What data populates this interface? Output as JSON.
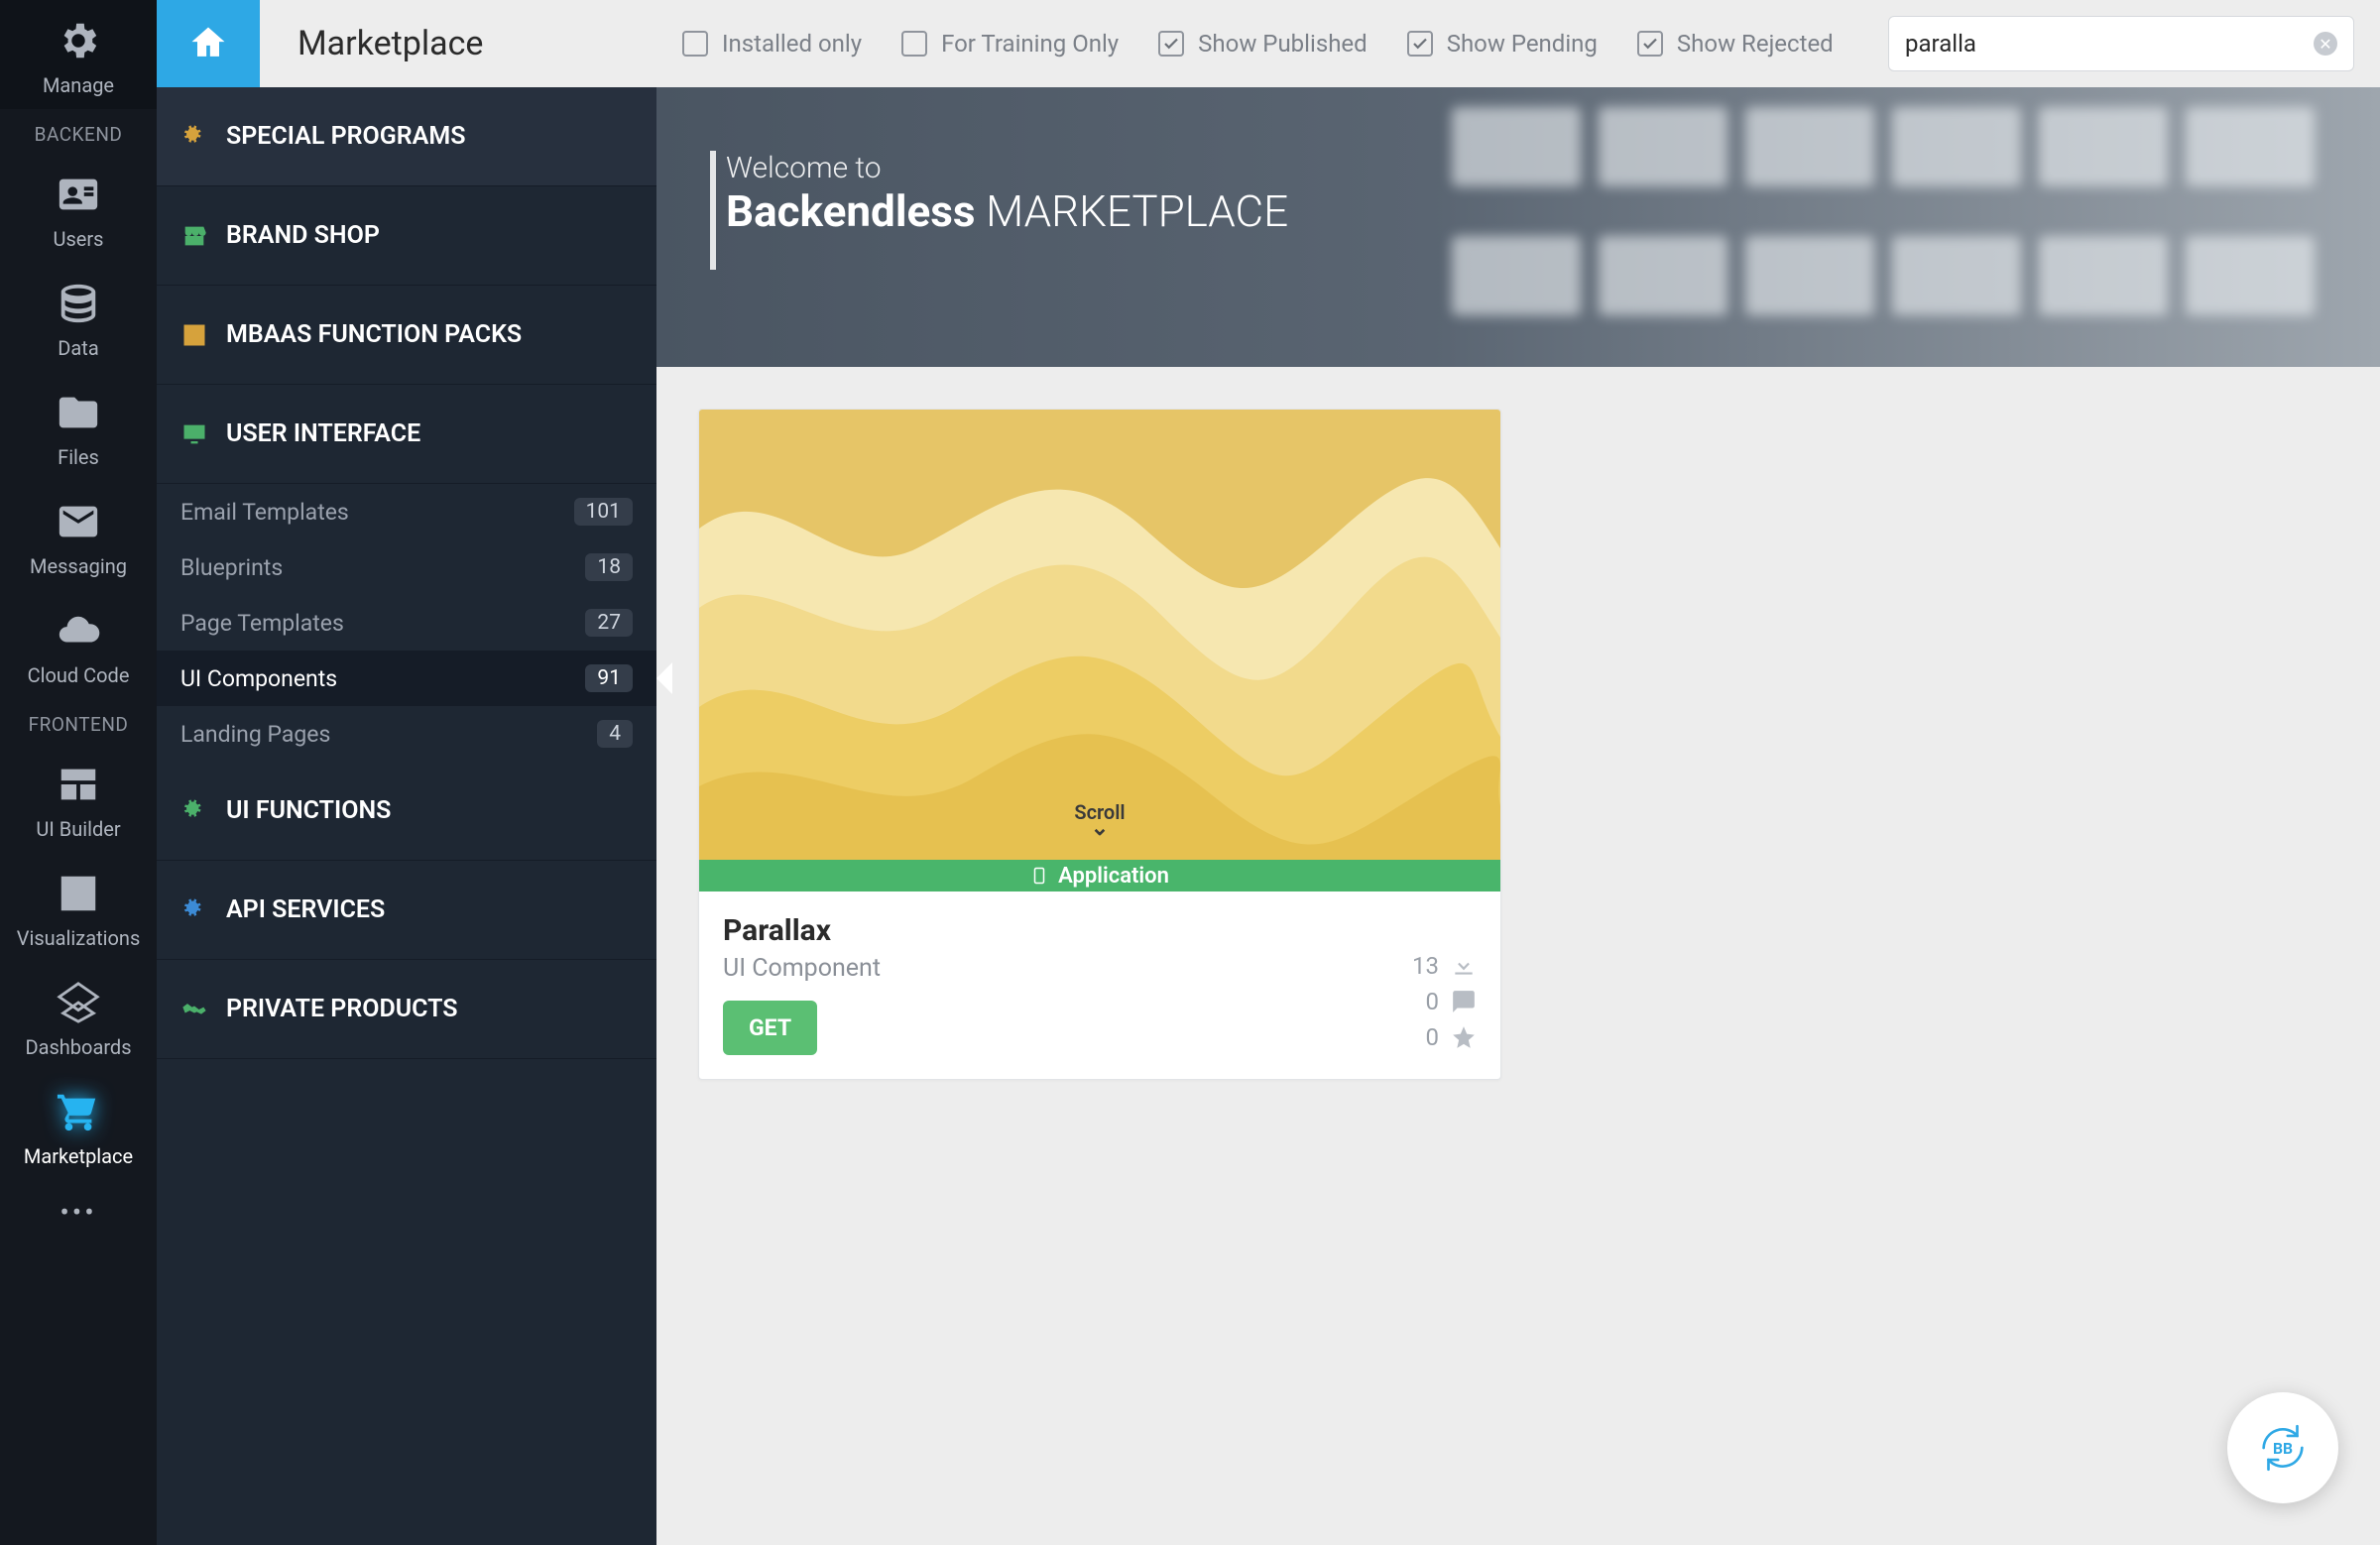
{
  "header": {
    "title": "Marketplace"
  },
  "rail": {
    "manage": "Manage",
    "section_backend": "BACKEND",
    "users": "Users",
    "data": "Data",
    "files": "Files",
    "messaging": "Messaging",
    "cloudcode": "Cloud Code",
    "section_frontend": "FRONTEND",
    "uibuilder": "UI Builder",
    "visualizations": "Visualizations",
    "dashboards": "Dashboards",
    "marketplace": "Marketplace"
  },
  "categories": {
    "special": "SPECIAL PROGRAMS",
    "brand": "BRAND SHOP",
    "mbaas": "MBAAS FUNCTION PACKS",
    "ui": "USER INTERFACE",
    "ui_items": [
      {
        "label": "Email Templates",
        "count": "101"
      },
      {
        "label": "Blueprints",
        "count": "18"
      },
      {
        "label": "Page Templates",
        "count": "27"
      },
      {
        "label": "UI Components",
        "count": "91"
      },
      {
        "label": "Landing Pages",
        "count": "4"
      }
    ],
    "uifunc": "UI FUNCTIONS",
    "api": "API SERVICES",
    "private": "PRIVATE PRODUCTS"
  },
  "filters": {
    "installed": "Installed only",
    "training": "For Training Only",
    "published": "Show Published",
    "pending": "Show Pending",
    "rejected": "Show Rejected",
    "search_value": "paralla"
  },
  "hero": {
    "welcome": "Welcome to",
    "brand": "Backendless",
    "suffix": "MARKETPLACE"
  },
  "card": {
    "scroll_label": "Scroll",
    "tag": "Application",
    "name": "Parallax",
    "type": "UI Component",
    "button": "GET",
    "downloads": "13",
    "comments": "0",
    "stars": "0"
  }
}
